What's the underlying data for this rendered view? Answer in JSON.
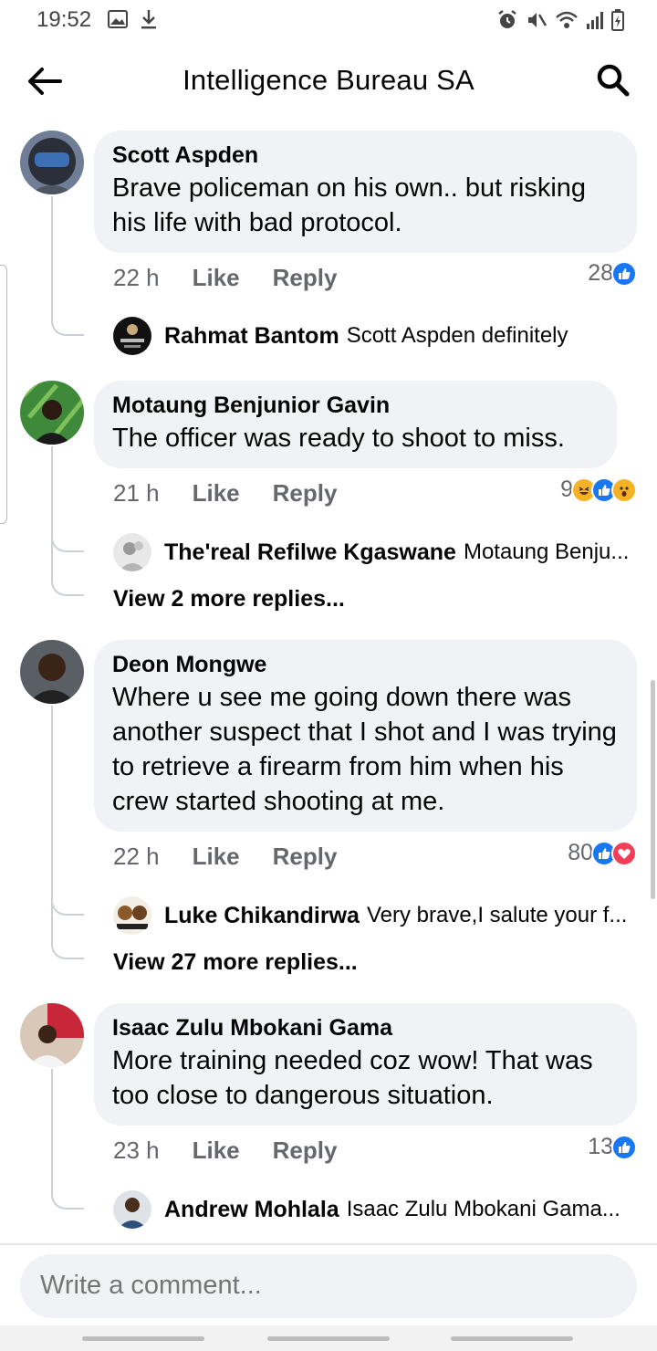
{
  "status_bar": {
    "time": "19:52"
  },
  "header": {
    "title": "Intelligence Bureau SA"
  },
  "comments": [
    {
      "author": "Scott Aspden",
      "text": "Brave policeman on his own..  but risking his life with bad protocol.",
      "time": "22 h",
      "like": "Like",
      "reply": "Reply",
      "reaction_count": "28",
      "reactions": [
        "like-icon"
      ],
      "replies": [
        {
          "author": "Rahmat Bantom",
          "text": "Scott Aspden definitely"
        }
      ]
    },
    {
      "author": "Motaung Benjunior Gavin",
      "text": "The officer was ready to shoot to miss.",
      "time": "21 h",
      "like": "Like",
      "reply": "Reply",
      "reaction_count": "9",
      "reactions": [
        "haha-icon",
        "like-icon",
        "wow-icon"
      ],
      "replies": [
        {
          "author": "The'real Refilwe Kgaswane",
          "text": "Motaung Benju..."
        }
      ],
      "more_replies": "View 2 more replies..."
    },
    {
      "author": "Deon Mongwe",
      "text": "Where u see me going down there was another suspect  that I shot and I was trying to retrieve a firearm from him when his crew started  shooting  at me.",
      "time": "22 h",
      "like": "Like",
      "reply": "Reply",
      "reaction_count": "80",
      "reactions": [
        "like-icon",
        "love-icon"
      ],
      "replies": [
        {
          "author": "Luke Chikandirwa",
          "text": "Very brave,I salute your f..."
        }
      ],
      "more_replies": "View 27 more replies..."
    },
    {
      "author": "Isaac Zulu Mbokani Gama",
      "text": "More training needed coz wow! That was too close to dangerous situation.",
      "time": "23 h",
      "like": "Like",
      "reply": "Reply",
      "reaction_count": "13",
      "reactions": [
        "like-icon"
      ],
      "replies": [
        {
          "author": "Andrew Mohlala",
          "text": "Isaac Zulu Mbokani Gama..."
        }
      ]
    }
  ],
  "composer": {
    "placeholder": "Write a comment..."
  },
  "colors": {
    "bubble": "#f0f2f5",
    "like_blue": "#1877f2",
    "love_red": "#f33e58",
    "haha_yellow": "#f7b125",
    "meta_gray": "#65676b"
  }
}
